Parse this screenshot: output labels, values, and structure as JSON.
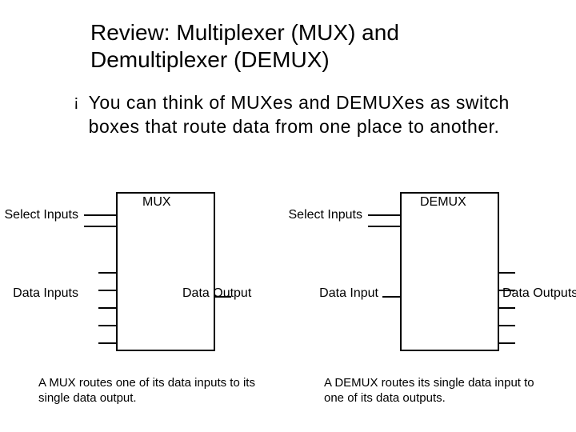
{
  "title_line1": "Review: Multiplexer (MUX) and",
  "title_line2": "Demultiplexer (DEMUX)",
  "bullet_mark": "¡",
  "bullet_text": "You can think of MUXes and DEMUXes as switch boxes that route data from one place to another.",
  "mux": {
    "box_label": "MUX",
    "select_label": "Select Inputs",
    "data_label": "Data Inputs",
    "output_label": "Data Output",
    "caption": "A MUX routes one of its data inputs to its single data output."
  },
  "demux": {
    "box_label": "DEMUX",
    "select_label": "Select Inputs",
    "data_label": "Data Input",
    "output_label": "Data Outputs",
    "caption": "A DEMUX routes its single data input to one of its data outputs."
  }
}
